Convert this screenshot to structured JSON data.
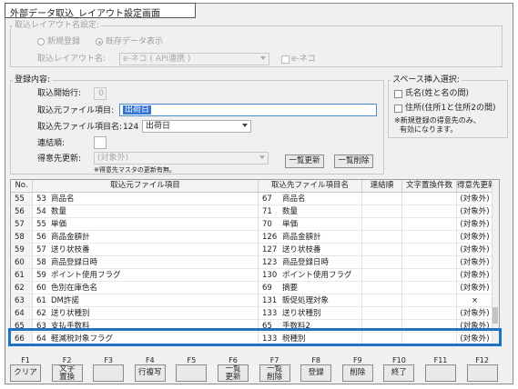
{
  "window": {
    "title": "外部データ取込_レイアウト設定画面"
  },
  "layout_name_group": {
    "title": "取込レイアウト名設定:",
    "radio_new": "新規登録",
    "radio_existing": "既存データ表示",
    "layout_label": "取込レイアウト名:",
    "layout_value": "e-ネコ ( API連携 )",
    "check_label": "e-ネコ"
  },
  "registration_group": {
    "title": "登録内容:",
    "start_row_label": "取込開始行:",
    "start_row_value": "0",
    "source_item_label": "取込元ファイル項目:",
    "source_item_value": "出荷日",
    "dest_item_label": "取込先ファイル項目名:",
    "dest_item_code": "124",
    "dest_item_value": "出荷日",
    "concat_label": "連結順:",
    "concat_value": "",
    "customer_update_label": "得意先更新:",
    "customer_update_value": "(対象外)",
    "customer_note": "※得意先マスタの更新有無。",
    "bulk_update_button": "一覧更新",
    "bulk_delete_button": "一覧削除"
  },
  "space_group": {
    "title": "スペース挿入選択:",
    "opt_name": "氏名(姓と名の間)",
    "opt_address": "住所(住所1と住所2の間)",
    "note_line1": "※新規登録の得意先のみ、",
    "note_line2": "有効になります。"
  },
  "table": {
    "headers": [
      "No.",
      "取込元ファイル項目",
      "取込先ファイル項目名",
      "連結順",
      "文字置換件数",
      "得意先更新"
    ],
    "rows": [
      {
        "no": "55",
        "src_no": "53",
        "src": "商品名",
        "dst_no": "67",
        "dst": "商品名",
        "ren": "",
        "rep": "",
        "upd": "(対象外)"
      },
      {
        "no": "56",
        "src_no": "54",
        "src": "数量",
        "dst_no": "71",
        "dst": "数量",
        "ren": "",
        "rep": "",
        "upd": "(対象外)"
      },
      {
        "no": "57",
        "src_no": "55",
        "src": "単価",
        "dst_no": "70",
        "dst": "単価",
        "ren": "",
        "rep": "",
        "upd": "(対象外)"
      },
      {
        "no": "58",
        "src_no": "56",
        "src": "商品金額計",
        "dst_no": "126",
        "dst": "商品金額計",
        "ren": "",
        "rep": "",
        "upd": "(対象外)"
      },
      {
        "no": "59",
        "src_no": "57",
        "src": "送り状枝番",
        "dst_no": "127",
        "dst": "送り状枝番",
        "ren": "",
        "rep": "",
        "upd": "(対象外)"
      },
      {
        "no": "60",
        "src_no": "58",
        "src": "商品登録日時",
        "dst_no": "123",
        "dst": "商品登録日時",
        "ren": "",
        "rep": "",
        "upd": "(対象外)"
      },
      {
        "no": "61",
        "src_no": "59",
        "src": "ポイント使用フラグ",
        "dst_no": "130",
        "dst": "ポイント使用フラグ",
        "ren": "",
        "rep": "",
        "upd": "(対象外)"
      },
      {
        "no": "62",
        "src_no": "60",
        "src": "色別在庫色名",
        "dst_no": "69",
        "dst": "摘要",
        "ren": "",
        "rep": "",
        "upd": "(対象外)"
      },
      {
        "no": "63",
        "src_no": "61",
        "src": "DM許諾",
        "dst_no": "131",
        "dst": "販促処理対象",
        "ren": "",
        "rep": "",
        "upd": "×"
      },
      {
        "no": "64",
        "src_no": "62",
        "src": "送り状種別",
        "dst_no": "133",
        "dst": "送り状種別",
        "ren": "",
        "rep": "",
        "upd": "(対象外)"
      },
      {
        "no": "65",
        "src_no": "63",
        "src": "支払手数料",
        "dst_no": "65",
        "dst": "手数料2",
        "ren": "",
        "rep": "",
        "upd": "(対象外)"
      },
      {
        "no": "66",
        "src_no": "64",
        "src": "軽減税対象フラグ",
        "dst_no": "133",
        "dst": "税種別",
        "ren": "",
        "rep": "",
        "upd": "(対象外)"
      }
    ]
  },
  "fkeys": [
    {
      "key": "F1",
      "label": "クリア"
    },
    {
      "key": "F2",
      "label": "文字\n置換"
    },
    {
      "key": "F3",
      "label": ""
    },
    {
      "key": "F4",
      "label": "行複写"
    },
    {
      "key": "F5",
      "label": ""
    },
    {
      "key": "F6",
      "label": "一覧\n更新"
    },
    {
      "key": "F7",
      "label": "一覧\n削除"
    },
    {
      "key": "F8",
      "label": "登録"
    },
    {
      "key": "F9",
      "label": "削除"
    },
    {
      "key": "F10",
      "label": "終了"
    },
    {
      "key": "F11",
      "label": ""
    },
    {
      "key": "F12",
      "label": ""
    }
  ]
}
